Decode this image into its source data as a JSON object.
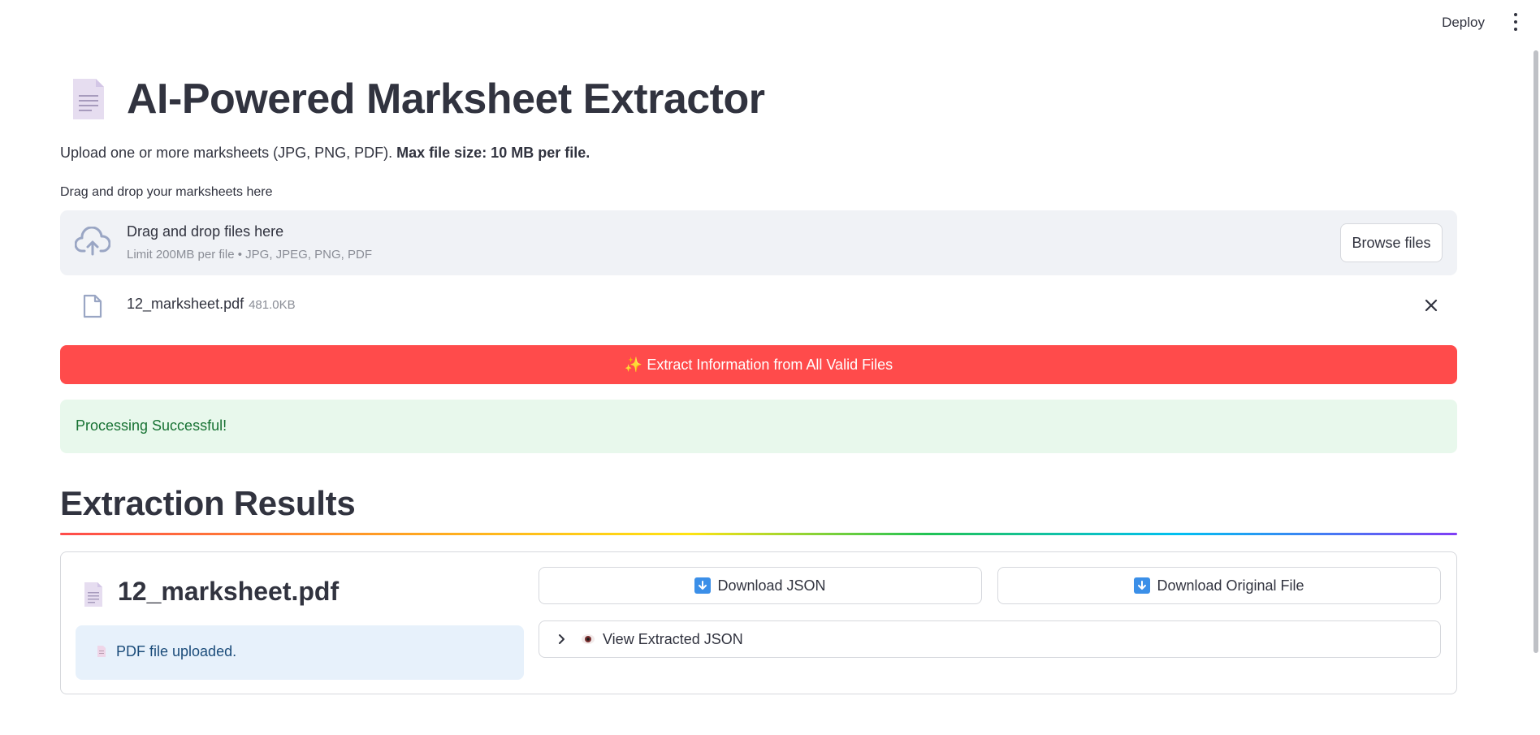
{
  "header": {
    "deploy_label": "Deploy",
    "menu_icon": "kebab-menu-icon"
  },
  "page": {
    "title": "AI-Powered Marksheet Extractor",
    "title_icon": "document-icon",
    "intro_text": "Upload one or more marksheets (JPG, PNG, PDF). ",
    "intro_bold": "Max file size: 10 MB per file."
  },
  "uploader": {
    "label": "Drag and drop your marksheets here",
    "drop_main": "Drag and drop files here",
    "drop_sub": "Limit 200MB per file • JPG, JPEG, PNG, PDF",
    "browse_label": "Browse files",
    "icon": "cloud-upload-icon"
  },
  "uploaded_files": [
    {
      "name": "12_marksheet.pdf",
      "size": "481.0KB",
      "icon": "file-icon"
    }
  ],
  "extract_button": {
    "label": "✨ Extract Information from All Valid Files"
  },
  "status": {
    "message": "Processing Successful!"
  },
  "results": {
    "heading": "Extraction Results",
    "items": [
      {
        "file_name": "12_marksheet.pdf",
        "info_text": "PDF file uploaded.",
        "download_json_label": "Download JSON",
        "download_original_label": "Download Original File",
        "expander_label": "View Extracted JSON"
      }
    ]
  },
  "colors": {
    "primary": "#ff4b4b",
    "success_bg": "#e8f8ec",
    "success_text": "#177233",
    "info_bg": "#e7f1fb",
    "info_text": "#1b4c7a",
    "text": "#31333f"
  }
}
